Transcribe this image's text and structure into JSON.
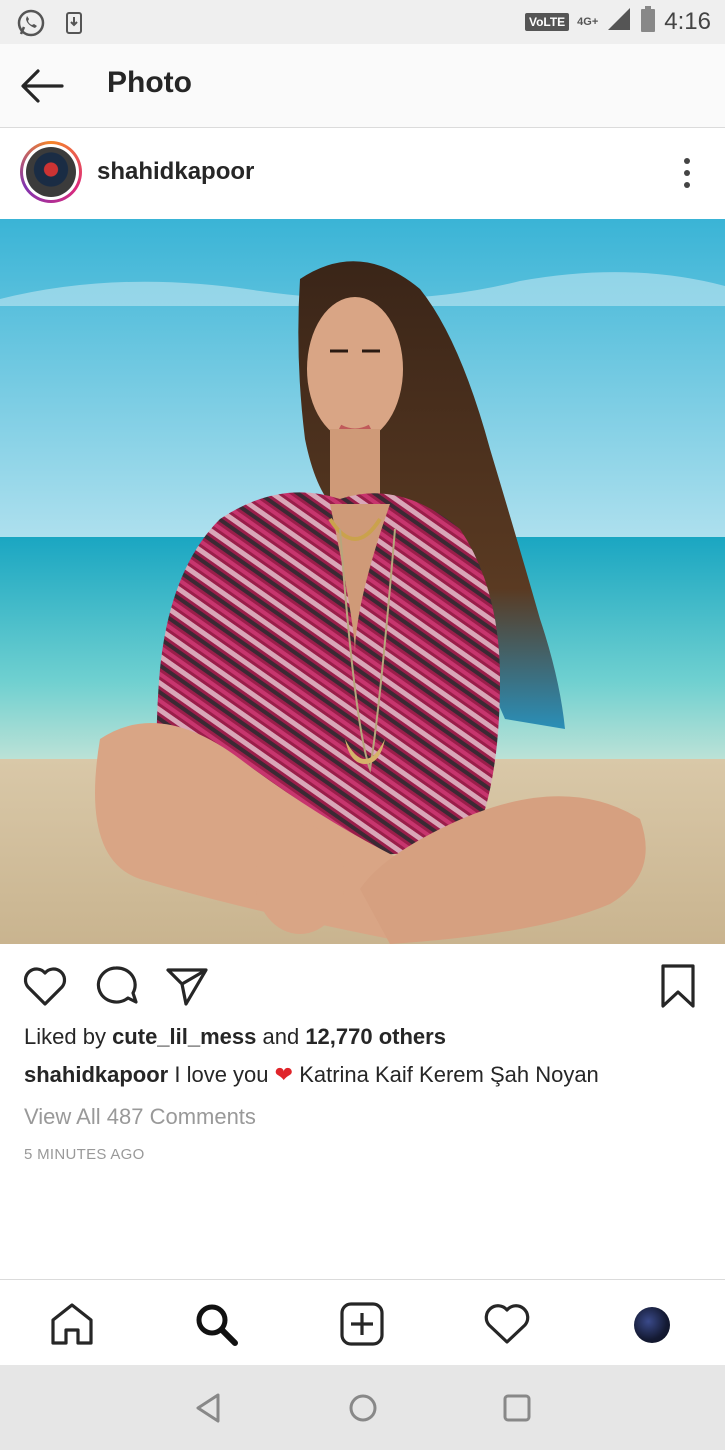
{
  "status_bar": {
    "volte": "VoLTE",
    "network": "4G+",
    "time": "4:16",
    "icons": [
      "whatsapp-icon",
      "download-icon",
      "signal-icon",
      "battery-icon"
    ]
  },
  "app_bar": {
    "title": "Photo",
    "back_icon": "back-arrow-icon"
  },
  "post": {
    "username": "shahidkapoor",
    "avatar_ring_colors": [
      "#f58529",
      "#dd2a7b",
      "#8134af"
    ],
    "photo_description_icon": "beach-photo",
    "likes": {
      "prefix": "Liked by ",
      "first_user": "cute_lil_mess",
      "middle": " and ",
      "count_text": "12,770 others"
    },
    "caption": {
      "author": "shahidkapoor",
      "text_before": " I love you ",
      "heart": "❤",
      "text_after": " Katrina Kaif Kerem Şah Noyan"
    },
    "view_comments": "View All 487 Comments",
    "time_ago": "5 MINUTES AGO"
  },
  "actions": [
    "heart-icon",
    "comment-icon",
    "share-icon",
    "bookmark-icon"
  ],
  "tab_bar": [
    "home-icon",
    "search-icon",
    "add-post-icon",
    "activity-heart-icon",
    "profile-avatar"
  ],
  "nav_bar": [
    "back-triangle-icon",
    "home-circle-icon",
    "recents-square-icon"
  ],
  "colors": {
    "status_bar_bg": "#efefef",
    "nav_bar_bg": "#e6e6e6",
    "text": "#262626",
    "muted": "#999999",
    "heart_red": "#e0242a"
  }
}
